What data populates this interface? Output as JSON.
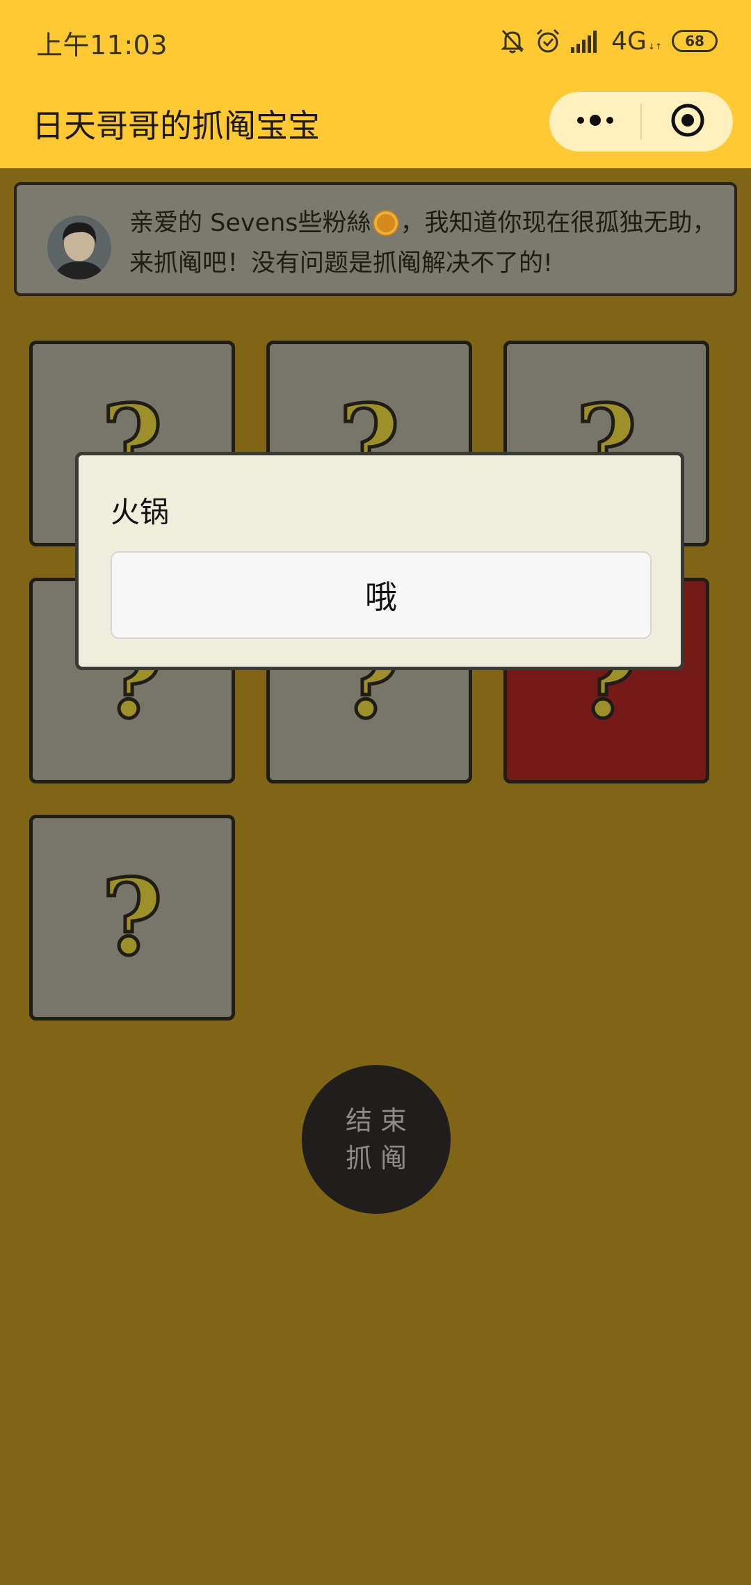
{
  "status_bar": {
    "time": "上午11:03",
    "network": "4G",
    "network_sub": "↓↑",
    "battery": "68"
  },
  "app": {
    "title": "日天哥哥的抓阄宝宝"
  },
  "banner": {
    "text_before": "亲爱的 Sevens些粉絲",
    "text_after": "，我知道你现在很孤独无助，来抓阄吧！没有问题是抓阄解决不了的!"
  },
  "cards": [
    {
      "label": "?",
      "state": "hidden"
    },
    {
      "label": "?",
      "state": "hidden"
    },
    {
      "label": "?",
      "state": "hidden"
    },
    {
      "label": "?",
      "state": "hidden"
    },
    {
      "label": "?",
      "state": "hidden"
    },
    {
      "label": "?",
      "state": "revealed"
    },
    {
      "label": "?",
      "state": "hidden"
    }
  ],
  "end_button": {
    "line1": "结束",
    "line2": "抓阄"
  },
  "modal": {
    "title": "火锅",
    "button_label": "哦"
  },
  "colors": {
    "header": "#fec933",
    "background": "#7f6515",
    "card": "#787569",
    "card_revealed": "#741b19",
    "end_button": "#1f1e1c",
    "modal": "#efeedc"
  }
}
